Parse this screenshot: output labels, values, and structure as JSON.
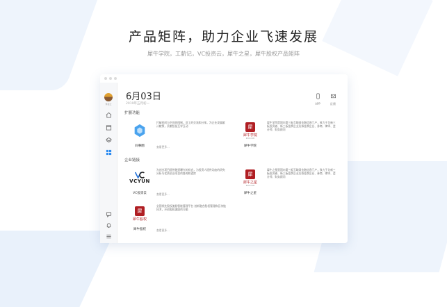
{
  "hero": {
    "title": "产品矩阵，助力企业飞速发展",
    "subtitle": "犀牛学院，工薪记，VC投资云，犀牛之星，犀牛股权产品矩阵"
  },
  "sidebar": {
    "username": "黄祖云",
    "items": [
      {
        "icon": "home-icon"
      },
      {
        "icon": "calendar-icon"
      },
      {
        "icon": "layers-icon"
      },
      {
        "icon": "grid-icon"
      }
    ],
    "bottom_items": [
      {
        "icon": "chat-icon"
      },
      {
        "icon": "bell-icon"
      },
      {
        "icon": "menu-icon"
      }
    ]
  },
  "header": {
    "date": "6月03日",
    "lunar": "2019年五月初一",
    "tools": [
      {
        "icon": "phone-icon",
        "label": "APP"
      },
      {
        "icon": "feedback-icon",
        "label": "反馈"
      }
    ]
  },
  "sections": [
    {
      "title": "扩展功能",
      "cards": [
        {
          "name": "同事圈",
          "desc": "打破时间与空间的限制，员工的交流和分享。为企业发展献计献策，贡献智慧互学互动",
          "more": "查看更多..."
        },
        {
          "name": "犀牛学院",
          "desc": "犀牛学院是国内第三板互联网金融信息门户，致力于为新三板投资者、新三板挂牌企业及拟挂牌企业、券商、律师、会计师、财务顾问",
          "more": "查看更多..."
        }
      ]
    },
    {
      "title": "企业链接",
      "cards": [
        {
          "name": "VC投资云",
          "desc": "为创业项目提供融资曝光的机会，为投资人提供动态的研究分析与优质创业项目的查询和追踪",
          "more": "查看更多..."
        },
        {
          "name": "犀牛之星",
          "desc": "犀牛之星是国内第三板互联网金融信息门户，致力于为新三板投资者、新三板挂牌企业及拟挂牌企业、券商、律师、会计师、财务顾问",
          "more": "查看更多..."
        },
        {
          "name": "犀牛股权",
          "desc": "全国领先股权激励智能管理平台 创新融合股权管理和区块链技术，开创股权激励的可能",
          "more": "查看更多..."
        }
      ]
    }
  ],
  "logos": {
    "vcyun": "VCYUN",
    "xnxy_seal": "犀",
    "xnxy_title": "犀牛学院",
    "xnxy_sub": "IPOS.COM",
    "xnzx_seal": "犀",
    "xnzx_title": "犀牛之星",
    "xnzx_sub": "IPOS.COM",
    "xngq_seal": "犀",
    "xngq_title": "犀牛股权"
  },
  "colors": {
    "accent": "#2d8cf0",
    "brand_red": "#b01e23"
  }
}
